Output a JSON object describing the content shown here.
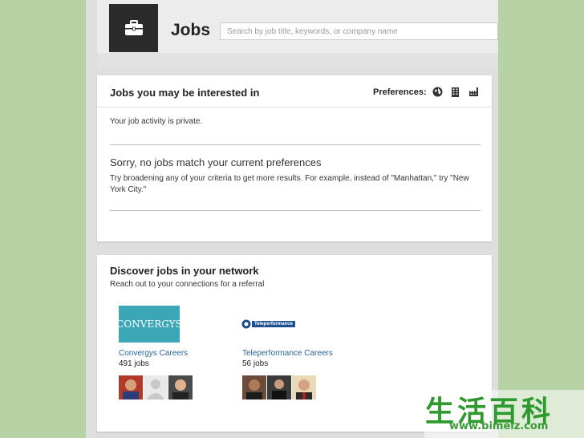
{
  "header": {
    "title": "Jobs",
    "search_placeholder": "Search by job title, keywords, or company name"
  },
  "interested": {
    "title": "Jobs you may be interested in",
    "preferences_label": "Preferences:",
    "pref_icons": [
      "globe-icon",
      "building-icon",
      "factory-icon"
    ],
    "privacy_text": "Your job activity is private.",
    "no_match_heading": "Sorry, no jobs match your current preferences",
    "no_match_line1": "Try broadening any of your criteria to get more results. For example, instead of \"Manhattan,\" try \"New",
    "no_match_line2": "York City.\""
  },
  "network": {
    "title": "Discover jobs in your network",
    "subtitle": "Reach out to your connections for a referral",
    "companies": [
      {
        "logo_text": "CONVERGYS",
        "name": "Convergys Careers",
        "jobs": "491 jobs"
      },
      {
        "logo_text": "Teleperformance",
        "name": "Teleperformance Careers",
        "jobs": "56 jobs"
      }
    ]
  },
  "watermark": {
    "chars": "生活百科",
    "url": "www.bimeiz.com"
  },
  "colors": {
    "link": "#2a6496",
    "convergys_bg": "#3ba6b6",
    "tile": "#2b2b2b",
    "watermark": "#2e9a2e"
  }
}
